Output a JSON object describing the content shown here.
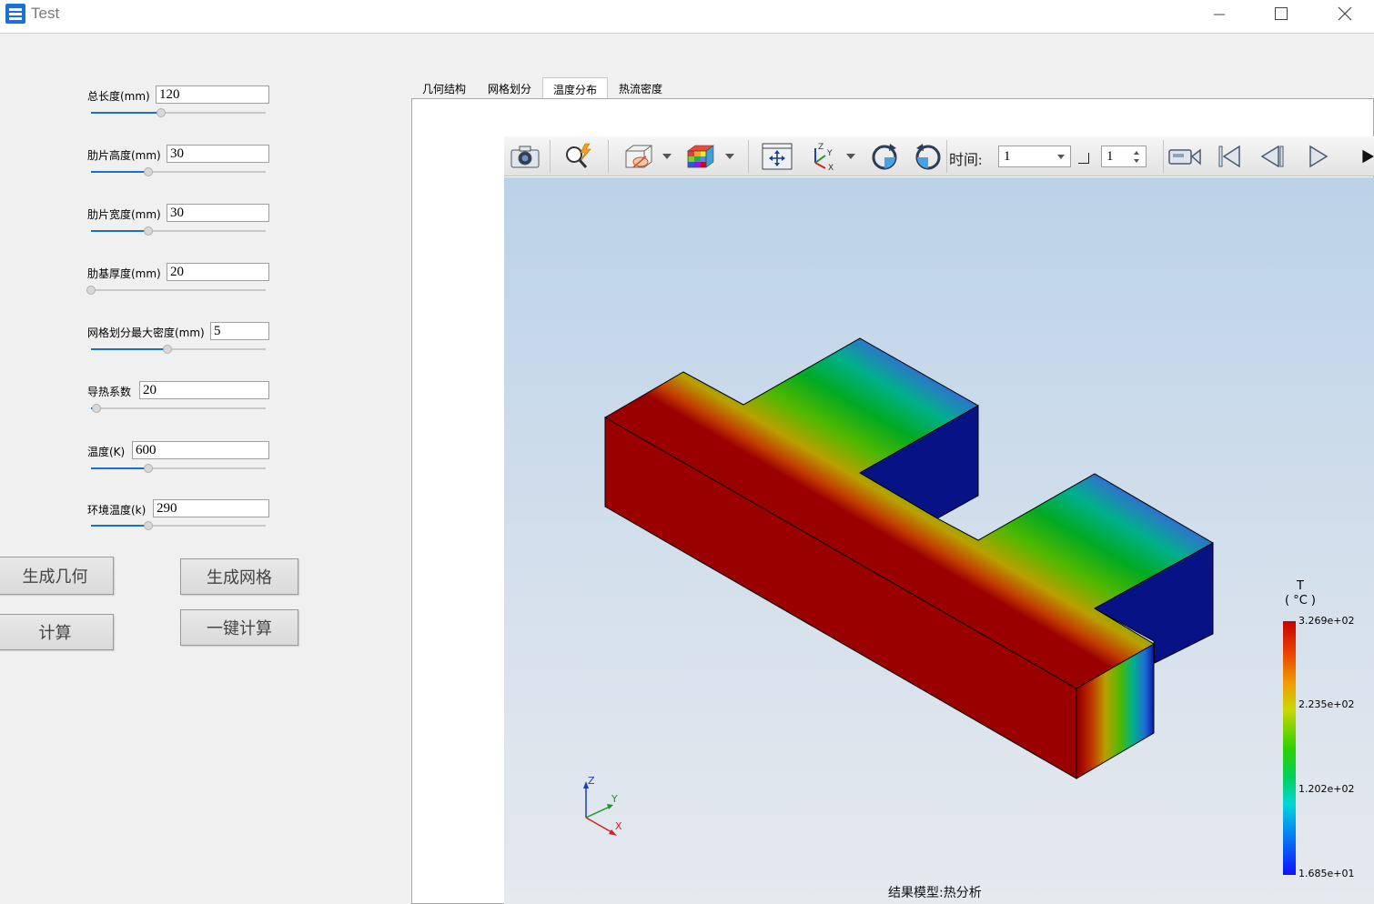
{
  "window": {
    "title": "Test"
  },
  "params": [
    {
      "label": "总长度(mm)",
      "value": "120",
      "slider_fraction": 0.4
    },
    {
      "label": "肋片高度(mm)",
      "value": "30",
      "slider_fraction": 0.33
    },
    {
      "label": "肋片宽度(mm)",
      "value": "30",
      "slider_fraction": 0.33
    },
    {
      "label": "肋基厚度(mm)",
      "value": "20",
      "slider_fraction": 0.0
    },
    {
      "label": "网格划分最大密度(mm)",
      "value": "5",
      "slider_fraction": 0.44
    },
    {
      "label": "导热系数",
      "value": "20",
      "slider_fraction": 0.03
    },
    {
      "label": "温度(K)",
      "value": "600",
      "slider_fraction": 0.33
    },
    {
      "label": "环境温度(k)",
      "value": "290",
      "slider_fraction": 0.33
    }
  ],
  "buttons": {
    "gen_geometry": "生成几何",
    "gen_mesh": "生成网格",
    "compute": "计算",
    "one_click": "一键计算"
  },
  "tabs": [
    {
      "label": "几何结构",
      "active": false
    },
    {
      "label": "网格划分",
      "active": false
    },
    {
      "label": "温度分布",
      "active": true
    },
    {
      "label": "热流密度",
      "active": false
    }
  ],
  "toolbar": {
    "icons": [
      "camera-icon",
      "zoom-icon",
      "display-mode-icon",
      "color-cube-icon",
      "fit-view-icon",
      "axes-icon",
      "rotate-cw-icon",
      "rotate-ccw-icon",
      "record-icon",
      "first-frame-icon",
      "previous-frame-icon",
      "play-icon"
    ],
    "time_label": "时间:",
    "time_value": "1",
    "step_value": "1"
  },
  "legend": {
    "title": "T",
    "unit": "( °C )",
    "max": "3.269e+02",
    "mid_high": "2.235e+02",
    "mid_low": "1.202e+02",
    "min": "1.685e+01"
  },
  "axes_triad": {
    "z": "Z",
    "y": "Y",
    "x": "X"
  },
  "caption": "结果模型:热分析",
  "colors": {
    "hot": "#9a0000",
    "cold": "#0a1294",
    "accent": "#1d6fc7"
  }
}
